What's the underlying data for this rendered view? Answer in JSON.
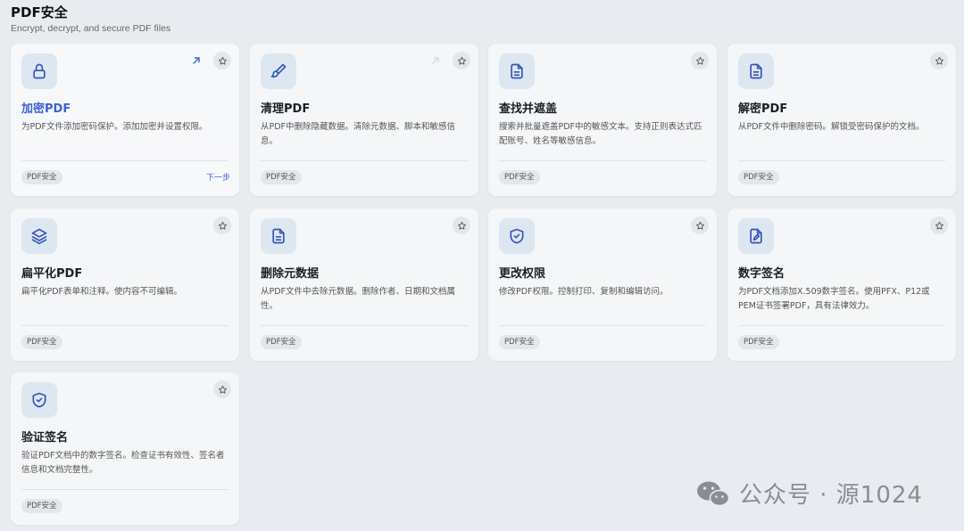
{
  "header": {
    "title": "PDF安全",
    "subtitle": "Encrypt, decrypt, and secure PDF files"
  },
  "cards": [
    {
      "title": "加密PDF",
      "desc": "为PDF文件添加密码保护。添加加密并设置权限。",
      "tag": "PDF安全",
      "icon": "lock-icon",
      "next": "下一步"
    },
    {
      "title": "清理PDF",
      "desc": "从PDF中删除隐藏数据。清除元数据、脚本和敏感信息。",
      "tag": "PDF安全",
      "icon": "brush-icon"
    },
    {
      "title": "查找并遮盖",
      "desc": "搜索并批量遮盖PDF中的敏感文本。支持正则表达式匹配账号、姓名等敏感信息。",
      "tag": "PDF安全",
      "icon": "document-icon"
    },
    {
      "title": "解密PDF",
      "desc": "从PDF文件中删除密码。解锁受密码保护的文档。",
      "tag": "PDF安全",
      "icon": "document-icon"
    },
    {
      "title": "扁平化PDF",
      "desc": "扁平化PDF表单和注释。使内容不可编辑。",
      "tag": "PDF安全",
      "icon": "layers-icon"
    },
    {
      "title": "删除元数据",
      "desc": "从PDF文件中去除元数据。删除作者、日期和文档属性。",
      "tag": "PDF安全",
      "icon": "document-icon"
    },
    {
      "title": "更改权限",
      "desc": "修改PDF权限。控制打印、复制和编辑访问。",
      "tag": "PDF安全",
      "icon": "shield-check-icon"
    },
    {
      "title": "数字签名",
      "desc": "为PDF文档添加X.509数字签名。使用PFX、P12或PEM证书签署PDF，具有法律效力。",
      "tag": "PDF安全",
      "icon": "file-signature-icon"
    },
    {
      "title": "验证签名",
      "desc": "验证PDF文档中的数字签名。检查证书有效性、签名者信息和文档完整性。",
      "tag": "PDF安全",
      "icon": "shield-check-icon"
    }
  ],
  "watermark": {
    "text": "公众号 · 源1024",
    "icon": "wechat-icon"
  },
  "colors": {
    "accent": "#3a62d8",
    "icon_stroke": "#3556b8",
    "icon_bg": "#dde7f1",
    "page_bg": "#e8ecf1"
  }
}
